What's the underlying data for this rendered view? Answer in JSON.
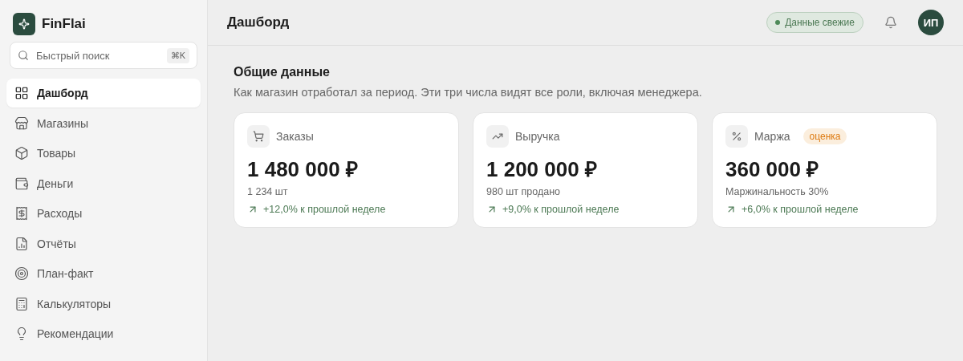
{
  "brand": {
    "name": "FinFlai"
  },
  "search": {
    "placeholder": "Быстрый поиск",
    "shortcut": "⌘K"
  },
  "sidebar": {
    "items": [
      {
        "label": "Дашборд",
        "selected": true
      },
      {
        "label": "Магазины",
        "selected": false
      },
      {
        "label": "Товары",
        "selected": false
      },
      {
        "label": "Деньги",
        "selected": false
      },
      {
        "label": "Расходы",
        "selected": false
      },
      {
        "label": "Отчёты",
        "selected": false
      },
      {
        "label": "План-факт",
        "selected": false
      },
      {
        "label": "Калькуляторы",
        "selected": false
      },
      {
        "label": "Рекомендации",
        "selected": false
      }
    ]
  },
  "header": {
    "title": "Дашборд",
    "status": "Данные свежие",
    "avatar": "ИП"
  },
  "section": {
    "title": "Общие данные",
    "subtitle": "Как магазин отработал за период. Эти три числа видят все роли, включая менеджера."
  },
  "cards": [
    {
      "label": "Заказы",
      "value": "1 480 000 ₽",
      "note": "1 234 шт",
      "change": "+12,0% к прошлой неделе"
    },
    {
      "label": "Выручка",
      "value": "1 200 000 ₽",
      "note": "980 шт продано",
      "change": "+9,0% к прошлой неделе"
    },
    {
      "label": "Маржа",
      "badge": "оценка",
      "value": "360 000 ₽",
      "note": "Маржинальность 30%",
      "change": "+6,0% к прошлой неделе"
    }
  ]
}
